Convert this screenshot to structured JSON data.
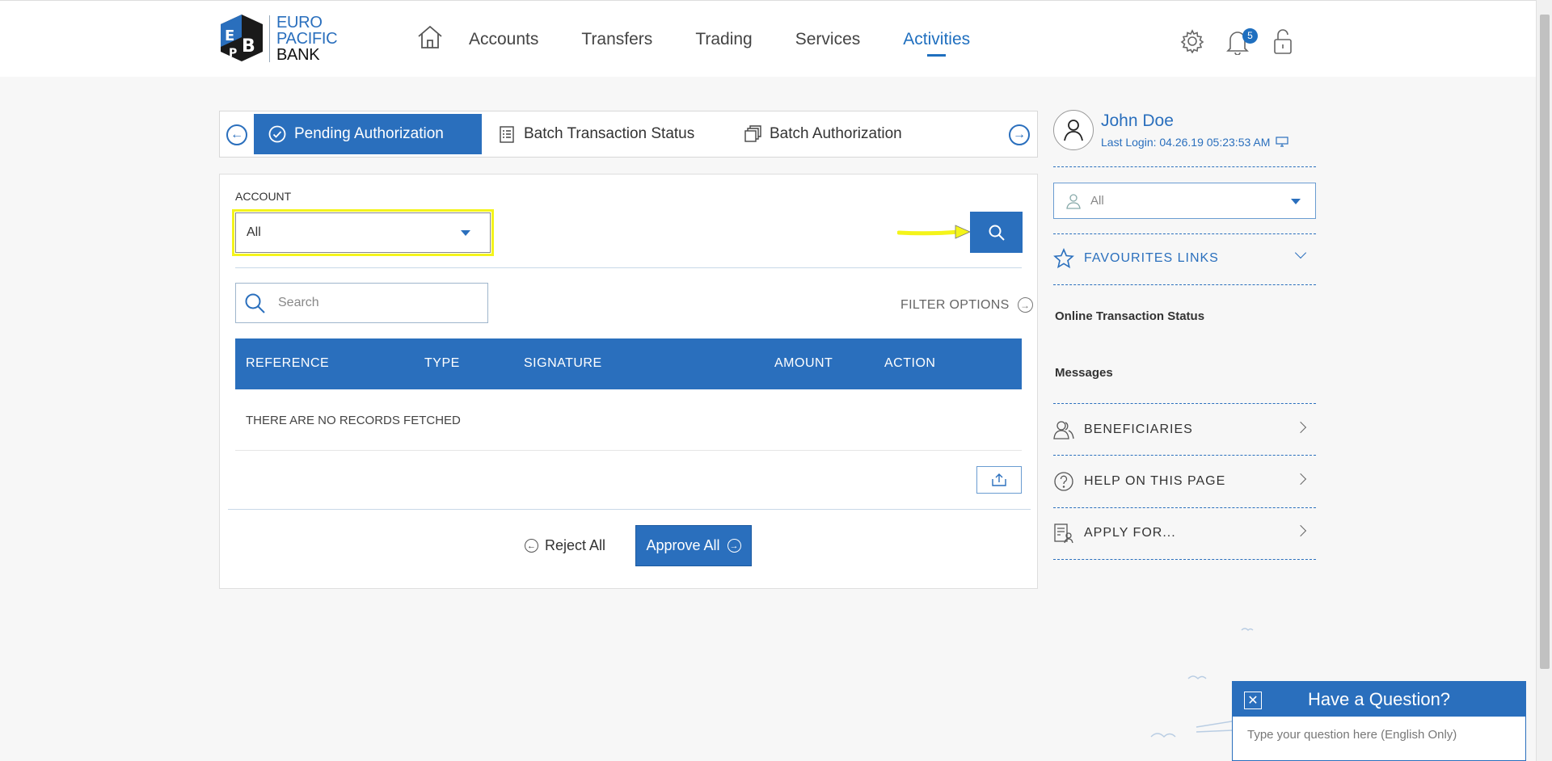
{
  "brand": {
    "line1": "EURO",
    "line2": "PACIFIC",
    "line3": "BANK"
  },
  "nav": [
    {
      "label": "Accounts",
      "active": false
    },
    {
      "label": "Transfers",
      "active": false
    },
    {
      "label": "Trading",
      "active": false
    },
    {
      "label": "Services",
      "active": false
    },
    {
      "label": "Activities",
      "active": true
    }
  ],
  "header": {
    "notification_count": "5",
    "icons": [
      "home-icon",
      "gear-icon",
      "bell-icon",
      "lock-icon"
    ]
  },
  "tabs": [
    {
      "label": "Pending Authorization",
      "active": true,
      "icon": "check-circle-icon"
    },
    {
      "label": "Batch Transaction Status",
      "active": false,
      "icon": "checklist-icon"
    },
    {
      "label": "Batch Authorization",
      "active": false,
      "icon": "stacked-docs-icon"
    }
  ],
  "account": {
    "label": "ACCOUNT",
    "selected": "All"
  },
  "search": {
    "placeholder": "Search"
  },
  "filter": {
    "label": "FILTER OPTIONS"
  },
  "table": {
    "columns": [
      "REFERENCE",
      "TYPE",
      "SIGNATURE",
      "AMOUNT",
      "ACTION"
    ],
    "empty_message": "THERE ARE NO RECORDS FETCHED"
  },
  "actions": {
    "reject": "Reject All",
    "approve": "Approve All"
  },
  "user": {
    "name": "John Doe",
    "last_login": "Last Login: 04.26.19 05:23:53 AM"
  },
  "sidebar": {
    "select_value": "All",
    "favourites": "FAVOURITES LINKS",
    "links": [
      "Online Transaction Status",
      "Messages"
    ],
    "rows": [
      "BENEFICIARIES",
      "HELP ON THIS PAGE",
      "APPLY FOR..."
    ]
  },
  "chat": {
    "title": "Have a Question?",
    "placeholder": "Type your question here (English Only)"
  },
  "colors": {
    "primary": "#2a6fbd",
    "highlight": "#f4f41a"
  }
}
